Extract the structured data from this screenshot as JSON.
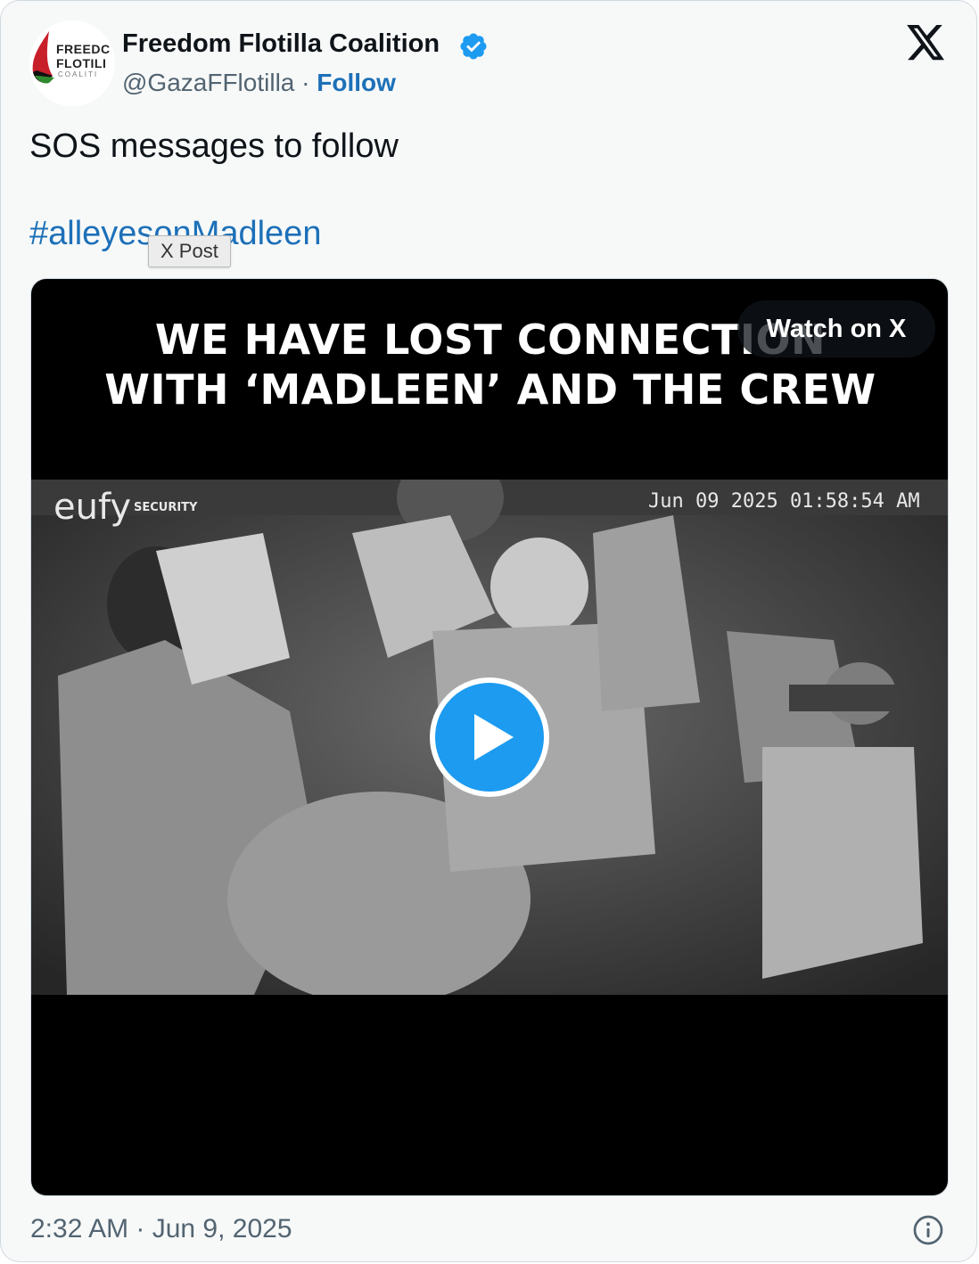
{
  "author": {
    "name": "Freedom Flotilla Coalition",
    "handle": "@GazaFFlotilla",
    "separator": "·",
    "follow_label": "Follow",
    "verified": true,
    "avatar_logo_text": [
      "FREEDC",
      "FLOTILI",
      "COALITI"
    ]
  },
  "post": {
    "text": "SOS messages to follow",
    "hashtag": "#alleyesonMadleen"
  },
  "tooltip": {
    "label": "X Post"
  },
  "media": {
    "headline_line1": "WE HAVE LOST CONNECTION",
    "headline_line2": "WITH ‘MADLEEN’ AND THE CREW",
    "watch_label": "Watch on X",
    "overlay_brand": "eufy",
    "overlay_brand_sub": "SECURITY",
    "overlay_timestamp": "Jun 09 2025   01:58:54 AM"
  },
  "footer": {
    "timestamp": "2:32 AM · Jun 9, 2025"
  },
  "icons": {
    "brand": "x-logo-icon",
    "verified": "verified-badge-icon",
    "play": "play-icon",
    "info": "info-icon"
  },
  "colors": {
    "link": "#1d70b8",
    "verified": "#1d9bf0",
    "play_button": "#1d9bf0",
    "text_primary": "#0f1419",
    "text_secondary": "#536471",
    "card_bg": "#f7f9f9"
  }
}
